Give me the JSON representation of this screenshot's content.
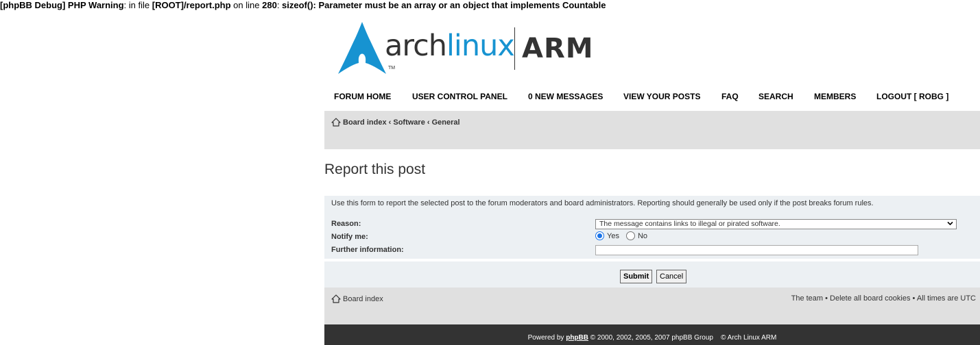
{
  "debug": {
    "prefix": "[phpBB Debug] PHP Warning",
    "in_file": ": in file ",
    "file": "[ROOT]/report.php",
    "on_line": " on line ",
    "line": "280",
    "sep": ": ",
    "message": "sizeof(): Parameter must be an array or an object that implements Countable"
  },
  "logo": {
    "arch": "arch",
    "linux": "linux",
    "arm": "ARM",
    "tm": "TM"
  },
  "nav": {
    "items": [
      "FORUM HOME",
      "USER CONTROL PANEL",
      "0 NEW MESSAGES",
      "VIEW YOUR POSTS",
      "FAQ",
      "SEARCH",
      "MEMBERS",
      "LOGOUT [ ROBG ]"
    ]
  },
  "breadcrumb": {
    "items": [
      "Board index",
      "Software",
      "General"
    ],
    "separator": " ‹ "
  },
  "page": {
    "title": "Report this post"
  },
  "form": {
    "intro": "Use this form to report the selected post to the forum moderators and board administrators. Reporting should generally be used only if the post breaks forum rules.",
    "reason_label": "Reason:",
    "reason_value": "The message contains links to illegal or pirated software.",
    "notify_label": "Notify me:",
    "notify_yes": "Yes",
    "notify_no": "No",
    "further_label": "Further information:",
    "further_value": ""
  },
  "buttons": {
    "submit": "Submit",
    "cancel": "Cancel"
  },
  "footer": {
    "board_index": "Board index",
    "team": "The team",
    "delete_cookies": "Delete all board cookies",
    "times": "All times are UTC",
    "powered_by": "Powered by ",
    "phpbb": "phpBB",
    "copyright": " © 2000, 2002, 2005, 2007 phpBB Group    © Arch Linux ARM"
  },
  "colors": {
    "accent": "#1793d1",
    "dark_footer": "#333333",
    "panel_bg": "#ecf0f3",
    "bar_bg": "#e0e0e0"
  }
}
